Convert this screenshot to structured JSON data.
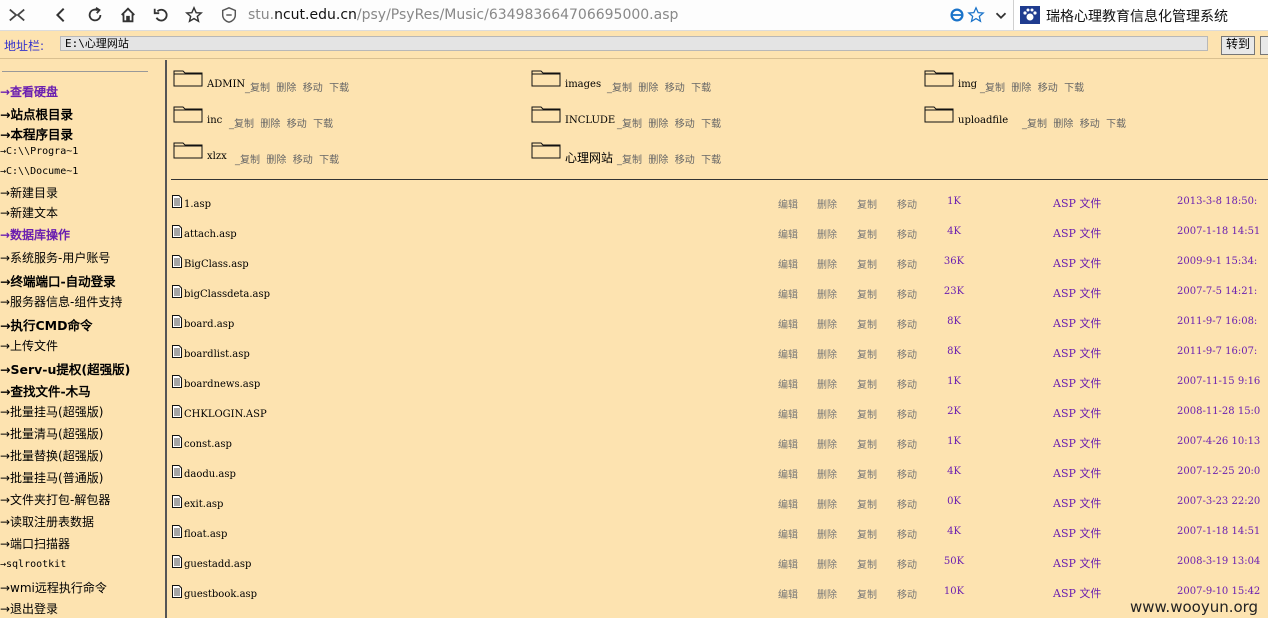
{
  "browser": {
    "url_prefix": "stu.",
    "url_domain": "ncut.edu.cn",
    "url_path": "/psy/PsyRes/Music/634983664706695000.asp",
    "tab_title": "瑞格心理教育信息化管理系统"
  },
  "address": {
    "label": "地址栏:",
    "value": "E:\\心理网站",
    "go": "转到"
  },
  "sidebar": {
    "items": [
      {
        "label": "→查看硬盘"
      },
      {
        "label": "→站点根目录"
      },
      {
        "label": "→本程序目录"
      },
      {
        "label": "→C:\\\\Progra~1"
      },
      {
        "label": "→C:\\\\Docume~1"
      },
      {
        "label": "→新建目录"
      },
      {
        "label": "→新建文本"
      },
      {
        "label": "→数据库操作"
      },
      {
        "label": "→系统服务-用户账号"
      },
      {
        "label": "→终端端口-自动登录"
      },
      {
        "label": "→服务器信息-组件支持"
      },
      {
        "label": "→执行CMD命令"
      },
      {
        "label": "→上传文件"
      },
      {
        "label": "→Serv-u提权(超强版)"
      },
      {
        "label": "→查找文件-木马"
      },
      {
        "label": "→批量挂马(超强版)"
      },
      {
        "label": "→批量清马(超强版)"
      },
      {
        "label": "→批量替换(超强版)"
      },
      {
        "label": "→批量挂马(普通版)"
      },
      {
        "label": "→文件夹打包-解包器"
      },
      {
        "label": "→读取注册表数据"
      },
      {
        "label": "→端口扫描器"
      },
      {
        "label": "→sqlrootkit"
      },
      {
        "label": "→wmi远程执行命令"
      },
      {
        "label": "→退出登录"
      }
    ]
  },
  "folder_actions": {
    "copy": "_复制",
    "delete": "删除",
    "move": "移动",
    "download": "下载"
  },
  "folders": [
    {
      "name": "ADMIN"
    },
    {
      "name": "images"
    },
    {
      "name": "img"
    },
    {
      "name": "inc"
    },
    {
      "name": "INCLUDE"
    },
    {
      "name": "uploadfile"
    },
    {
      "name": "xlzx"
    },
    {
      "name": "心理网站"
    }
  ],
  "file_actions": {
    "edit": "编辑",
    "delete": "删除",
    "copy": "复制",
    "move": "移动"
  },
  "files": [
    {
      "name": "1.asp",
      "size": "1K",
      "type": "ASP 文件",
      "date": "2013-3-8 18:50:"
    },
    {
      "name": "attach.asp",
      "size": "4K",
      "type": "ASP 文件",
      "date": "2007-1-18 14:51"
    },
    {
      "name": "BigClass.asp",
      "size": "36K",
      "type": "ASP 文件",
      "date": "2009-9-1 15:34:"
    },
    {
      "name": "bigClassdeta.asp",
      "size": "23K",
      "type": "ASP 文件",
      "date": "2007-7-5 14:21:"
    },
    {
      "name": "board.asp",
      "size": "8K",
      "type": "ASP 文件",
      "date": "2011-9-7 16:08:"
    },
    {
      "name": "boardlist.asp",
      "size": "8K",
      "type": "ASP 文件",
      "date": "2011-9-7 16:07:"
    },
    {
      "name": "boardnews.asp",
      "size": "1K",
      "type": "ASP 文件",
      "date": "2007-11-15 9:16"
    },
    {
      "name": "CHKLOGIN.ASP",
      "size": "2K",
      "type": "ASP 文件",
      "date": "2008-11-28 15:0"
    },
    {
      "name": "const.asp",
      "size": "1K",
      "type": "ASP 文件",
      "date": "2007-4-26 10:13"
    },
    {
      "name": "daodu.asp",
      "size": "4K",
      "type": "ASP 文件",
      "date": "2007-12-25 20:0"
    },
    {
      "name": "exit.asp",
      "size": "0K",
      "type": "ASP 文件",
      "date": "2007-3-23 22:20"
    },
    {
      "name": "float.asp",
      "size": "4K",
      "type": "ASP 文件",
      "date": "2007-1-18 14:51"
    },
    {
      "name": "guestadd.asp",
      "size": "50K",
      "type": "ASP 文件",
      "date": "2008-3-19 13:04"
    },
    {
      "name": "guestbook.asp",
      "size": "10K",
      "type": "ASP 文件",
      "date": "2007-9-10 15:42"
    }
  ],
  "watermark": "www.wooyun.org"
}
